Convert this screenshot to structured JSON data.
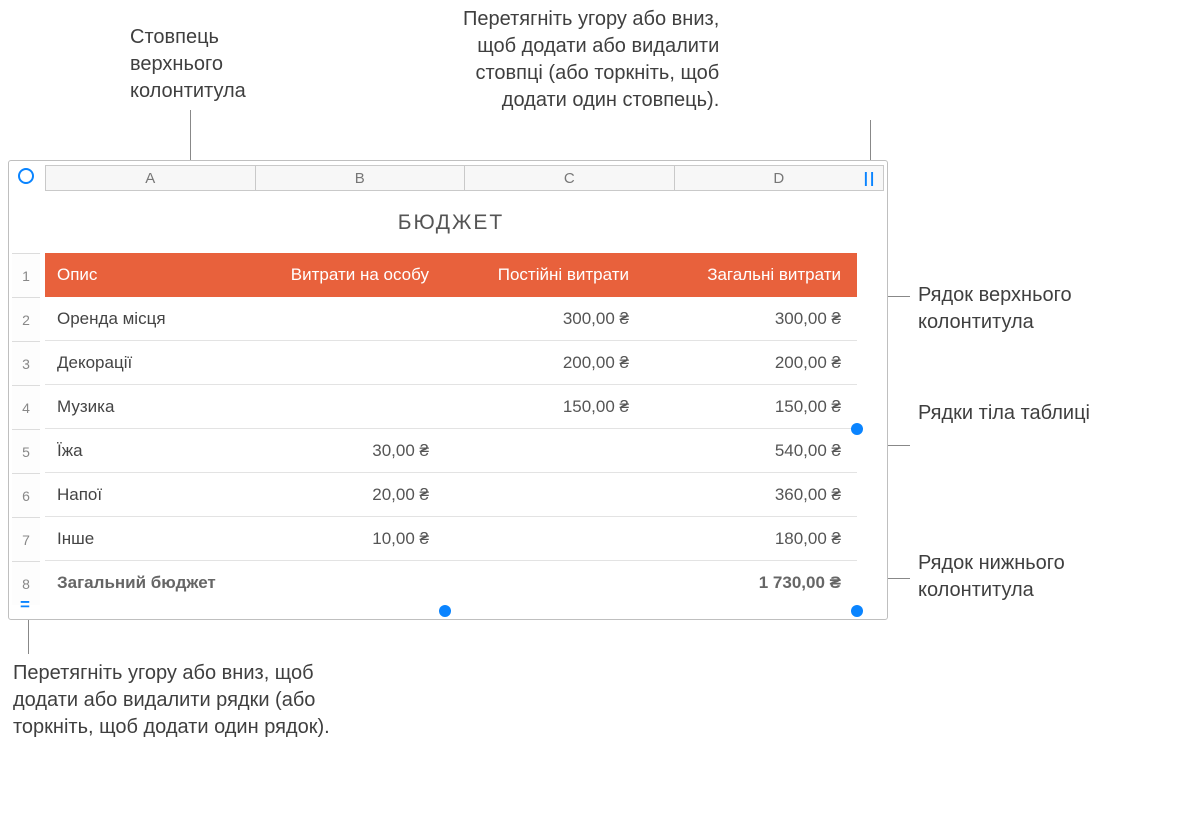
{
  "callouts": {
    "top_left": "Стовпець\nверхнього\nколонтитула",
    "top_right": "Перетягніть угору або вниз,\nщоб додати або видалити\nстовпці (або торкніть, щоб\nдодати один стовпець).",
    "right_header": "Рядок верхнього\nколонтитула",
    "right_body": "Рядки тіла таблиці",
    "right_footer": "Рядок нижнього\nколонтитула",
    "bottom_left": "Перетягніть угору або вниз, щоб\nдодати або видалити рядки (або\nторкніть, щоб додати один рядок)."
  },
  "columns": [
    "A",
    "B",
    "C",
    "D"
  ],
  "row_numbers": [
    "1",
    "2",
    "3",
    "4",
    "5",
    "6",
    "7",
    "8"
  ],
  "title": "БЮДЖЕТ",
  "header": {
    "c1": "Опис",
    "c2": "Витрати на особу",
    "c3": "Постійні витрати",
    "c4": "Загальні витрати"
  },
  "rows": [
    {
      "c1": "Оренда місця",
      "c2": "",
      "c3": "300,00 ₴",
      "c4": "300,00 ₴"
    },
    {
      "c1": "Декорації",
      "c2": "",
      "c3": "200,00 ₴",
      "c4": "200,00 ₴"
    },
    {
      "c1": "Музика",
      "c2": "",
      "c3": "150,00 ₴",
      "c4": "150,00 ₴"
    },
    {
      "c1": "Їжа",
      "c2": "30,00 ₴",
      "c3": "",
      "c4": "540,00 ₴"
    },
    {
      "c1": "Напої",
      "c2": "20,00 ₴",
      "c3": "",
      "c4": "360,00 ₴"
    },
    {
      "c1": "Інше",
      "c2": "10,00 ₴",
      "c3": "",
      "c4": "180,00 ₴"
    }
  ],
  "footer": {
    "c1": "Загальний бюджет",
    "c2": "",
    "c3": "",
    "c4": "1 730,00 ₴"
  },
  "icons": {
    "col_handle": "||",
    "row_handle": "="
  },
  "colors": {
    "accent": "#e8613c",
    "ui_blue": "#0a84ff"
  }
}
